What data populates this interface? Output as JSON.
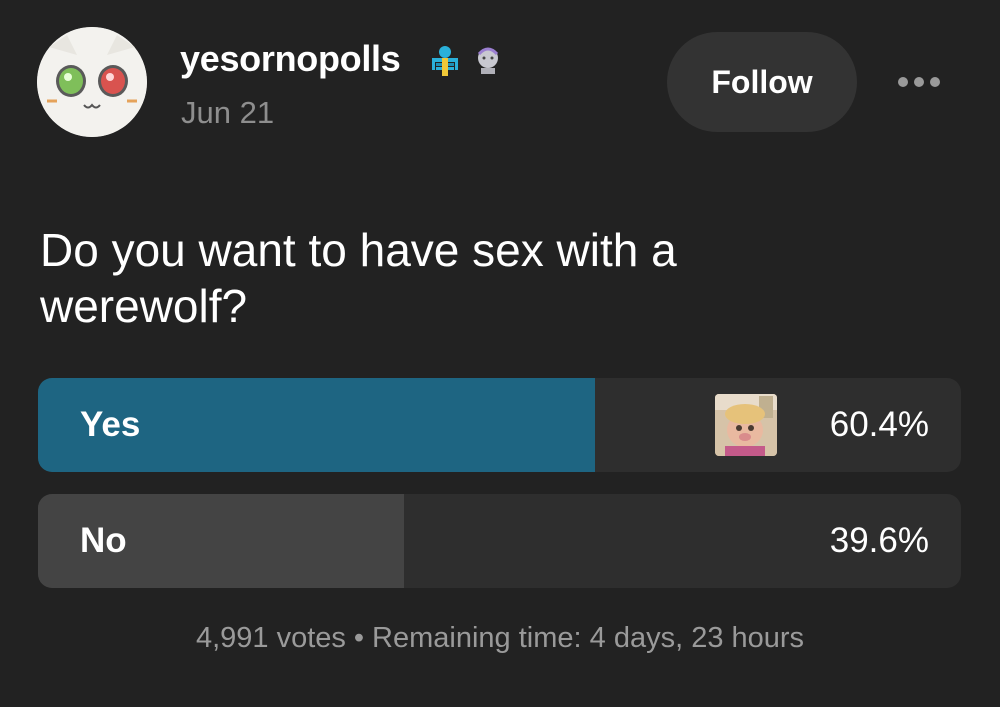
{
  "post": {
    "username": "yesornopolls",
    "date": "Jun 21",
    "follow_label": "Follow",
    "question": "Do you want to have sex with a werewolf?"
  },
  "poll": {
    "options": [
      {
        "label": "Yes",
        "percent": "60.4%",
        "fraction": 0.604,
        "color": "#1e6582"
      },
      {
        "label": "No",
        "percent": "39.6%",
        "fraction": 0.396,
        "color": "#444444"
      }
    ],
    "votes": "4,991 votes",
    "separator": "•",
    "remaining": "Remaining time: 4 days, 23 hours"
  },
  "colors": {
    "background": "#222222",
    "accent": "#1e6582",
    "secondary_text": "#8e8e8e"
  },
  "icons": {
    "avatar": "cat-avatar-icon",
    "badge_1": "blue-skeleton-badge-icon",
    "badge_2": "statue-head-badge-icon",
    "more": "ellipsis-icon",
    "voter": "voter-avatar-image"
  }
}
